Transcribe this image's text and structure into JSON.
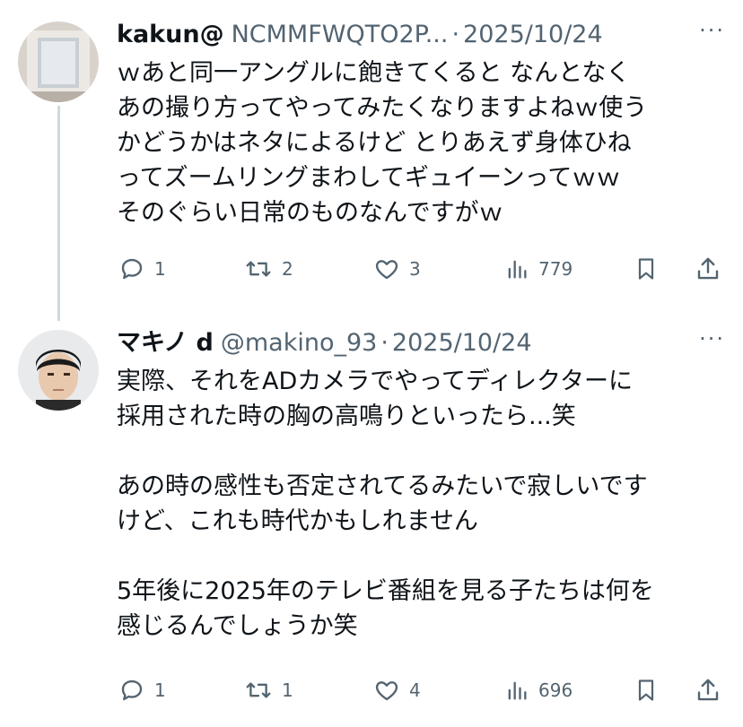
{
  "tweets": [
    {
      "name": "kakun@",
      "handle": "NCMMFWQTO2P...",
      "sep": "·",
      "date": "2025/10/24",
      "more": "···",
      "text": "ｗあと同一アングルに飽きてくると なんとなく\nあの撮り方ってやってみたくなりますよねｗ使う\nかどうかはネタによるけど とりあえず身体ひね\nってズームリングまわしてギュイーンってｗｗ\nそのぐらい日常のものなんですがｗ",
      "replies": "1",
      "reposts": "2",
      "likes": "3",
      "views": "779",
      "icons": [
        "reply-icon",
        "repost-icon",
        "like-icon",
        "views-icon",
        "bookmark-icon",
        "share-icon"
      ]
    },
    {
      "name": "マキノ d",
      "handle": "@makino_93",
      "sep": "·",
      "date": "2025/10/24",
      "more": "···",
      "text": "実際、それをADカメラでやってディレクターに\n採用された時の胸の高鳴りといったら...笑\n\nあの時の感性も否定されてるみたいで寂しいです\nけど、これも時代かもしれません\n\n5年後に2025年のテレビ番組を見る子たちは何を\n感じるんでしょうか笑",
      "replies": "1",
      "reposts": "1",
      "likes": "4",
      "views": "696",
      "icons": [
        "reply-icon",
        "repost-icon",
        "like-icon",
        "views-icon",
        "bookmark-icon",
        "share-icon"
      ]
    }
  ],
  "colors": {
    "text": "#0f1419",
    "secondary": "#536471",
    "thread_line": "#cfd9de"
  }
}
